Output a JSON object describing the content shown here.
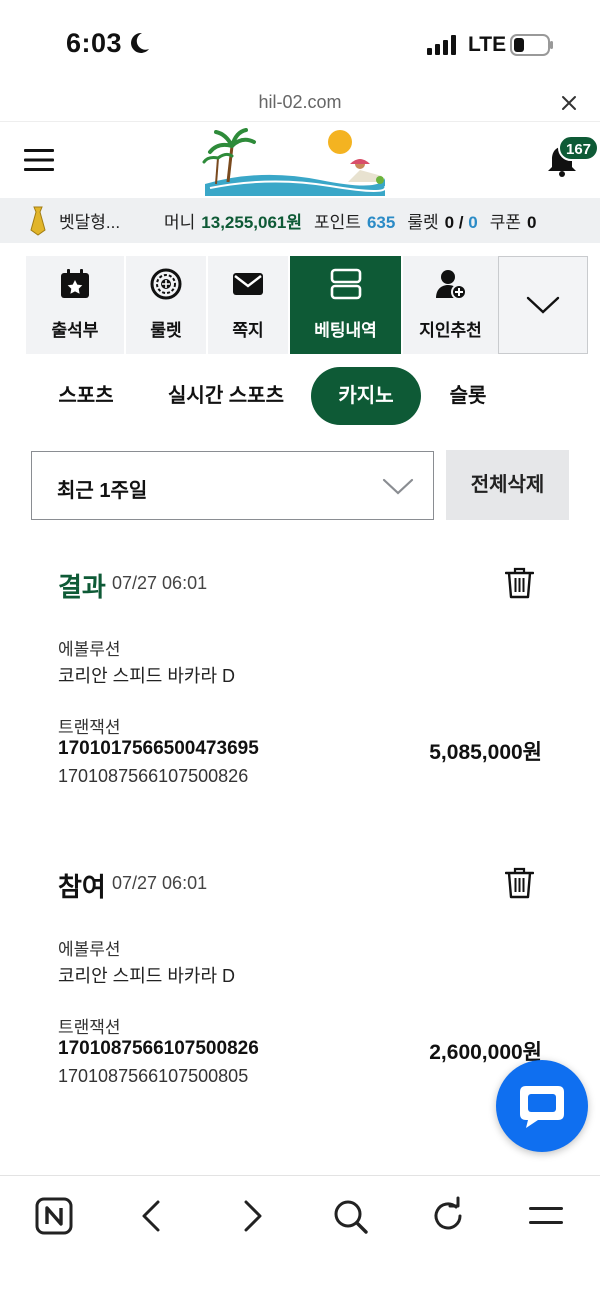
{
  "status_bar": {
    "time": "6:03",
    "network": "LTE"
  },
  "browser": {
    "url": "hil-02.com"
  },
  "header": {
    "logo_text": "휴양지",
    "notification_count": "167"
  },
  "user_bar": {
    "username": "벳달형...",
    "money_label": "머니",
    "money_value": "13,255,061원",
    "point_label": "포인트",
    "point_value": "635",
    "roulette_label": "룰렛",
    "roulette_used": "0",
    "roulette_sep": " / ",
    "roulette_total": "0",
    "coupon_label": "쿠폰",
    "coupon_value": "0"
  },
  "quick_nav": [
    {
      "label": "출석부",
      "icon": "calendar-star-icon"
    },
    {
      "label": "룰렛",
      "icon": "roulette-icon"
    },
    {
      "label": "쪽지",
      "icon": "envelope-icon"
    },
    {
      "label": "베팅내역",
      "icon": "betting-history-icon",
      "active": true
    },
    {
      "label": "지인추천",
      "icon": "user-add-icon"
    }
  ],
  "tabs": [
    {
      "label": "스포츠"
    },
    {
      "label": "실시간 스포츠"
    },
    {
      "label": "카지노",
      "active": true
    },
    {
      "label": "슬롯"
    }
  ],
  "filter": {
    "period": "최근 1주일",
    "delete_all": "전체삭제"
  },
  "records": [
    {
      "status": "결과",
      "datetime": "07/27 06:01",
      "provider_label": "에볼루션",
      "game": "코리안 스피드 바카라 D",
      "transaction_label": "트랜잭션",
      "transaction_id": "1701017566500473695",
      "ref_id": "1701087566107500826",
      "amount": "5,085,000원"
    },
    {
      "status": "참여",
      "datetime": "07/27 06:01",
      "provider_label": "에볼루션",
      "game": "코리안 스피드 바카라 D",
      "transaction_label": "트랜잭션",
      "transaction_id": "1701087566107500826",
      "ref_id": "1701087566107500805",
      "amount": "2,600,000원"
    }
  ],
  "colors": {
    "brand_green": "#0e5a36",
    "point_blue": "#2b8bc6",
    "chat_blue": "#0f6ff0"
  }
}
